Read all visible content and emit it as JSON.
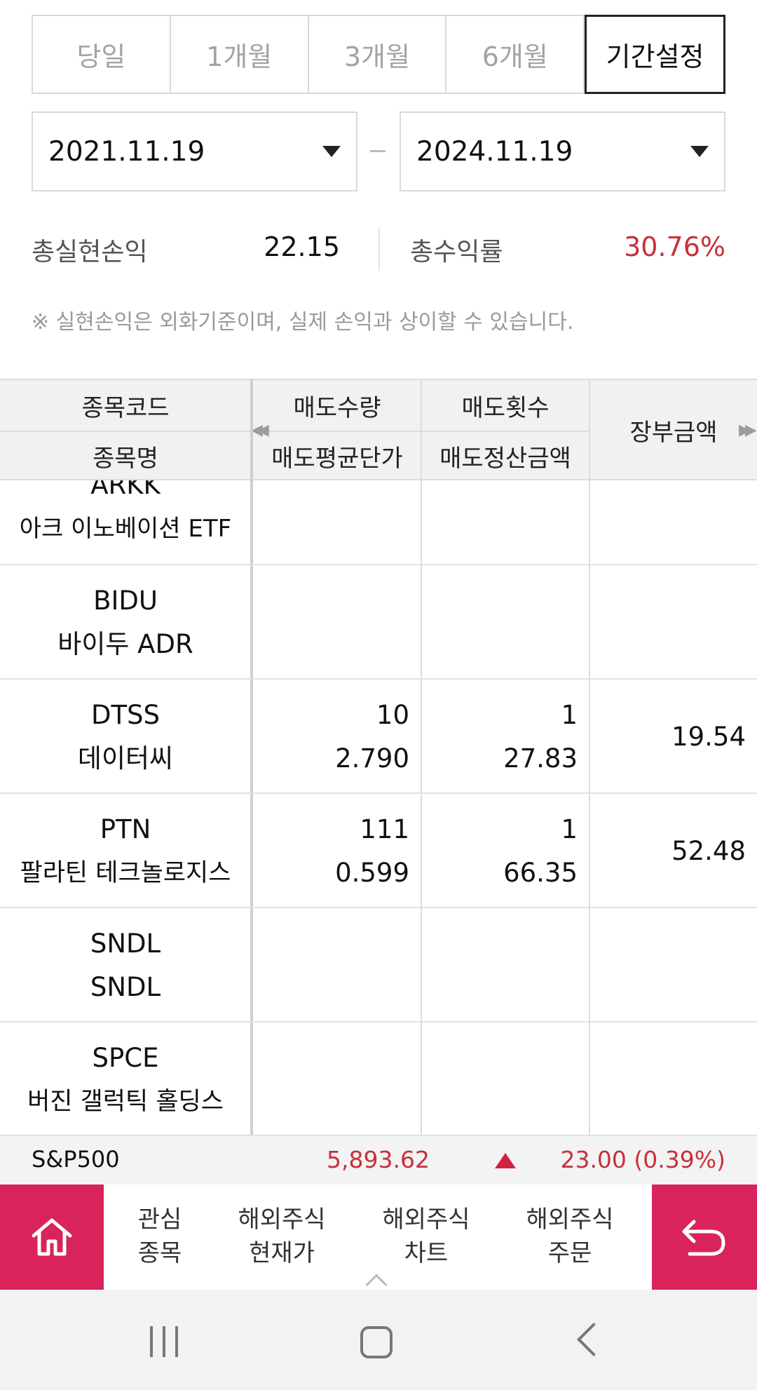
{
  "period_tabs": [
    "당일",
    "1개월",
    "3개월",
    "6개월",
    "기간설정"
  ],
  "active_tab": "기간설정",
  "date_range": {
    "from": "2021.11.19",
    "to": "2024.11.19"
  },
  "summary": {
    "total_realized_label": "총실현손익",
    "total_realized_value": "22.15",
    "total_return_label": "총수익률",
    "total_return_value": "30.76%"
  },
  "note": "※ 실현손익은 외화기준이며, 실제 손익과 상이할 수 있습니다.",
  "table": {
    "headers": {
      "code": "종목코드",
      "name": "종목명",
      "sell_qty": "매도수량",
      "sell_avg_price": "매도평균단가",
      "sell_count": "매도횟수",
      "sell_settle_amount": "매도정산금액",
      "book_amount": "장부금액"
    },
    "rows": [
      {
        "code": "ARKK",
        "name": "아크 이노베이션 ETF",
        "sell_qty": "",
        "sell_avg_price": "",
        "sell_count": "",
        "sell_settle_amount": "",
        "book_amount": ""
      },
      {
        "code": "BIDU",
        "name": "바이두 ADR",
        "sell_qty": "",
        "sell_avg_price": "",
        "sell_count": "",
        "sell_settle_amount": "",
        "book_amount": ""
      },
      {
        "code": "DTSS",
        "name": "데이터씨",
        "sell_qty": "10",
        "sell_avg_price": "2.790",
        "sell_count": "1",
        "sell_settle_amount": "27.83",
        "book_amount": "19.54"
      },
      {
        "code": "PTN",
        "name": "팔라틴 테크놀로지스",
        "sell_qty": "111",
        "sell_avg_price": "0.599",
        "sell_count": "1",
        "sell_settle_amount": "66.35",
        "book_amount": "52.48"
      },
      {
        "code": "SNDL",
        "name": "SNDL",
        "sell_qty": "",
        "sell_avg_price": "",
        "sell_count": "",
        "sell_settle_amount": "",
        "book_amount": ""
      },
      {
        "code": "SPCE",
        "name": "버진 갤럭틱 홀딩스",
        "sell_qty": "",
        "sell_avg_price": "",
        "sell_count": "",
        "sell_settle_amount": "",
        "book_amount": ""
      }
    ]
  },
  "ticker": {
    "name": "S&P500",
    "price": "5,893.62",
    "direction": "up",
    "change": "23.00 (0.39%)",
    "color": "#c8303a"
  },
  "bottom_nav": {
    "items": [
      {
        "line1": "관심",
        "line2": "종목"
      },
      {
        "line1": "해외주식",
        "line2": "현재가"
      },
      {
        "line1": "해외주식",
        "line2": "차트"
      },
      {
        "line1": "해외주식",
        "line2": "주문"
      }
    ],
    "accent_color": "#d9235b"
  }
}
